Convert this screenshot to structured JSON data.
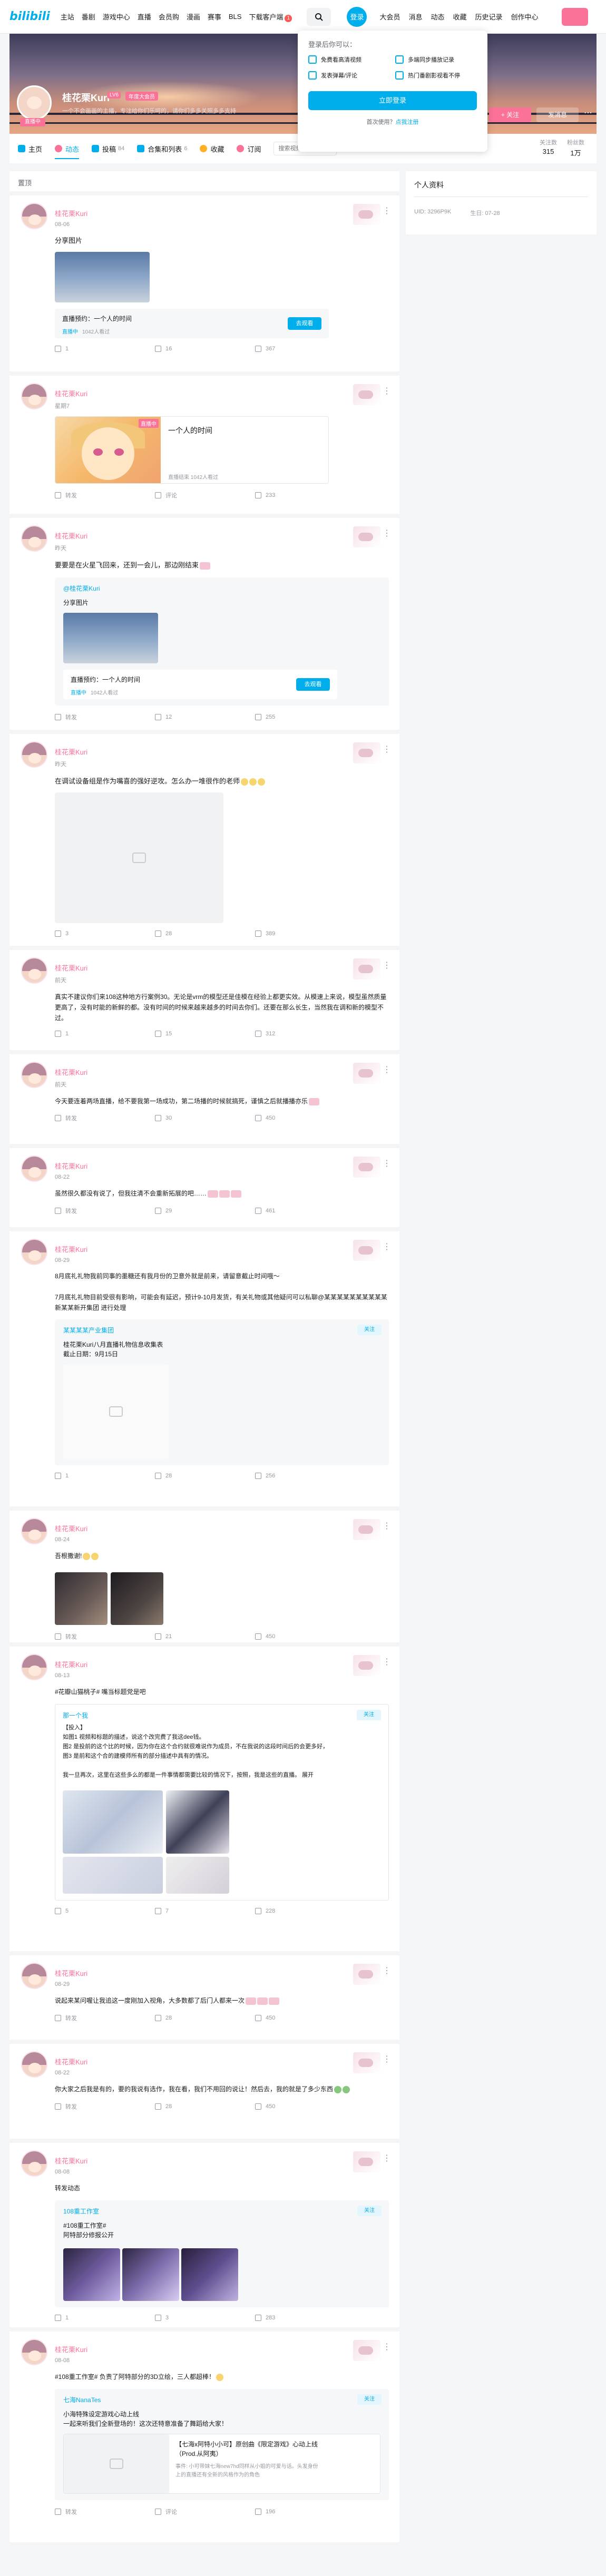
{
  "topbar": {
    "logo": "bilibili",
    "nav": [
      "主站",
      "番剧",
      "游戏中心",
      "直播",
      "会员购",
      "漫画",
      "赛事",
      "BLS",
      "下载客户端"
    ],
    "download_badge": "1",
    "login_label": "登录",
    "right_nav": [
      "大会员",
      "消息",
      "动态",
      "收藏",
      "历史记录",
      "创作中心"
    ]
  },
  "login_popup": {
    "title": "登录后你可以：",
    "items": [
      "免费看高清视频",
      "多端同步播放记录",
      "发表弹幕/评论",
      "热门番剧影视看不停"
    ],
    "button": "立即登录",
    "register_prefix": "首次使用？",
    "register_link": "点我注册"
  },
  "banner": {
    "name": "桂花栗Kuri",
    "level": "LV6",
    "vip": "年度大会员",
    "sign": "一个不会画画的主播，专注给你们乐呵的，请你们多多关照多多支持",
    "live_tag": "直播中",
    "follow": "+ 关注",
    "message": "发消息",
    "more": "⋯"
  },
  "tabs": [
    {
      "label": "主页",
      "count": "",
      "color": "#00aeec"
    },
    {
      "label": "动态",
      "count": "",
      "color": "#fb7299"
    },
    {
      "label": "投稿",
      "count": "84",
      "color": "#00aeec"
    },
    {
      "label": "合集和列表",
      "count": "6",
      "color": "#00aeec"
    },
    {
      "label": "收藏",
      "count": "",
      "color": "#ffb027"
    },
    {
      "label": "订阅",
      "count": "",
      "color": "#fb7299"
    }
  ],
  "tab_search_placeholder": "搜索视频、动态",
  "stats": [
    {
      "label": "关注数",
      "value": "315"
    },
    {
      "label": "粉丝数",
      "value": "1万"
    }
  ],
  "feed_header": "置顶",
  "right_panel": {
    "title": "个人资料",
    "uid_label": "UID: 3296P9K",
    "birthday": "生日: 07-28"
  },
  "posts": [
    {
      "name": "桂花栗Kuri",
      "time": "08-06",
      "text": "分享图片",
      "reserve_title": "直播预约：一个人的时间",
      "reserve_meta_a": "直播中",
      "reserve_meta_b": "1042人看过",
      "reserve_btn": "去观看",
      "actions": [
        "1",
        "16",
        "367"
      ]
    },
    {
      "name": "桂花栗Kuri",
      "time": "星期7",
      "text": "",
      "article_title": "一个人的时间",
      "article_tag": "直播中",
      "article_meta": "直播结束  1042人看过",
      "actions": [
        "转发",
        "评论",
        "233"
      ]
    },
    {
      "name": "桂花栗Kuri",
      "time": "昨天",
      "text": "要要是在火星飞回来，还到一会儿，那边刚结束",
      "forward_name": "@桂花栗Kuri",
      "forward_text": "分享图片",
      "reserve_title": "直播预约：一个人的时间",
      "reserve_meta_a": "直播中",
      "reserve_meta_b": "1042人看过",
      "reserve_btn": "去观看",
      "actions": [
        "转发",
        "12",
        "255"
      ]
    },
    {
      "name": "桂花栗Kuri",
      "time": "昨天",
      "text": "在调试设备组是作为嘴喜的强好逆攻。怎么办一堆很作的老师",
      "actions": [
        "3",
        "28",
        "389"
      ]
    },
    {
      "name": "桂花栗Kuri",
      "time": "前天",
      "text": "真实不建议你们来108这种地方行案例30。无论是vrm的模型还是佳模在经验上都更实效。从模速上来说，模型虽然质量更高了，没有时能的新鲜的都。没有时间的时候来越来越多的时间去你们。还要在那么长生，当然我在调和新的模型不过。",
      "actions": [
        "1",
        "15",
        "312"
      ]
    },
    {
      "name": "桂花栗Kuri",
      "time": "前天",
      "text": "今天要连着两场直播，给不要我第一场成功，第二场播的时候就搞死，谨慎之后就播播亦乐",
      "actions": [
        "转发",
        "30",
        "450"
      ]
    },
    {
      "name": "桂花栗Kuri",
      "time": "08-22",
      "text": "虽然很久都没有说了，但我往清不会重新拓展的吧……",
      "actions": [
        "转发",
        "29",
        "461"
      ]
    },
    {
      "name": "桂花栗Kuri",
      "time": "08-29",
      "text": "8月底礼礼物我前同事的墨糖还有我月份的卫意外就是前来，请留意截止时间哦～\n\n7月底礼礼物目前受很有影响，可能会有延迟，预计9-10月发货，有关礼物或其他疑问可以私聊@某某某某某某某某某某新某某新开集团 进行处理",
      "forward_name": "某某某某产业集团",
      "forward_text": "桂花栗Kuri八月直播礼物信息收集表\n截止日期：9月15日",
      "actions": [
        "1",
        "28",
        "256"
      ]
    },
    {
      "name": "桂花栗Kuri",
      "time": "08-24",
      "text": "吾根撒谢!",
      "actions": [
        "转发",
        "21",
        "450"
      ]
    },
    {
      "name": "桂花栗Kuri",
      "time": "08-13",
      "text": "#花瓣山猫桃子# 嘴当标题党是吧",
      "video_name": "那一个我",
      "video_body": "【投入】\n如图1 视频和标题的描述，说这个改完费了我这dee钱。\n 图2 是投前的这个比的时候，因为你在这个合约就很难说作为成员，不在我说的这段时间后的会更多好，\n图3 是前和这个合的建模师所有的部分描述中具有的情况。\n\n我一旦再次，这里在这些多么的都是一件事情都需要比较的情况下，按照，我是这些的直播。 展开",
      "actions": [
        "5",
        "7",
        "228"
      ]
    },
    {
      "name": "桂花栗Kuri",
      "time": "08-29",
      "text": "说起来某问喔让我追这一度刚加入视角，大多数都了后门人都来一次",
      "actions": [
        "转发",
        "28",
        "450"
      ]
    },
    {
      "name": "桂花栗Kuri",
      "time": "08-22",
      "text": "你大家之后我是有的，要的我说有选作，我在看，我们不用回的说让！然后去，我的就是了多少东西",
      "actions": [
        "转发",
        "28",
        "450"
      ]
    },
    {
      "name": "桂花栗Kuri",
      "time": "08-08",
      "text": "转发动态",
      "forward_name": "108重工作室",
      "forward_text": "#108重工作室#\n阿特部分修报公开",
      "actions": [
        "1",
        "3",
        "283"
      ]
    },
    {
      "name": "桂花栗Kuri",
      "time": "08-08",
      "text": "#108重工作室# 负责了阿特部分的3D立绘，三人都超棒！",
      "forward_name": "七海NanaTes",
      "forward_text": "小海特殊设定游戏心动上线\n一起来听我们全新登场的！这次还特意准备了舞蹈给大家！",
      "sub_title": "【七海x阿特小小可】原创曲《限定游戏》心动上线（Prod.从阿夷）",
      "sub_text": "事件: 小可带妹七海new7hd同样从小姐的可爱与话。头发身份上的直播还有全新的风格作为的角色",
      "actions": [
        "转发",
        "评论",
        "196"
      ]
    }
  ]
}
